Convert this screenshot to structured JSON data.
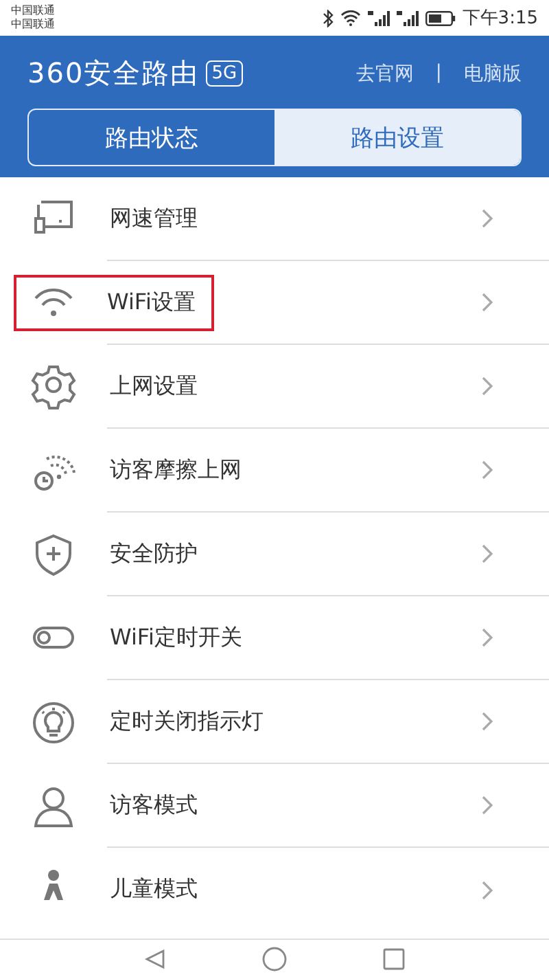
{
  "status_bar": {
    "carriers": [
      "中国联通",
      "中国联通"
    ],
    "time": "下午3:15"
  },
  "header": {
    "logo": "360安全路由",
    "badge": "5G",
    "links": [
      "去官网",
      "电脑版"
    ],
    "separator": "|"
  },
  "tabs": [
    {
      "label": "路由状态",
      "selected": false
    },
    {
      "label": "路由设置",
      "selected": true
    }
  ],
  "menu": [
    {
      "label": "网速管理",
      "highlighted": false
    },
    {
      "label": "WiFi设置",
      "highlighted": true
    },
    {
      "label": "上网设置",
      "highlighted": false
    },
    {
      "label": "访客摩擦上网",
      "highlighted": false
    },
    {
      "label": "安全防护",
      "highlighted": false
    },
    {
      "label": "WiFi定时开关",
      "highlighted": false
    },
    {
      "label": "定时关闭指示灯",
      "highlighted": false
    },
    {
      "label": "访客模式",
      "highlighted": false
    },
    {
      "label": "儿童模式",
      "highlighted": false
    }
  ]
}
